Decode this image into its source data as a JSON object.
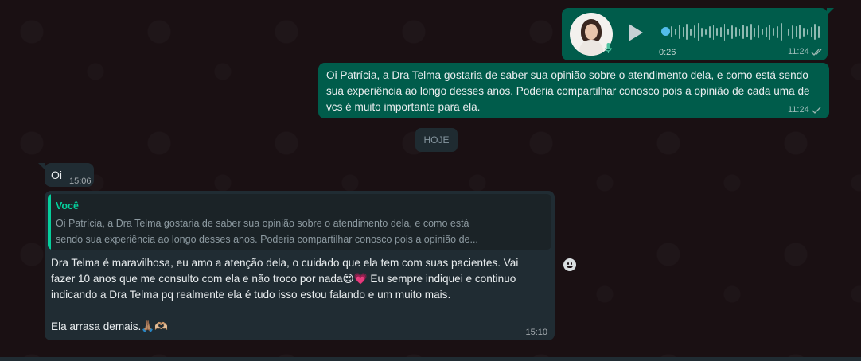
{
  "audio_message": {
    "duration": "0:26",
    "time": "11:24",
    "status_icon": "double-check-icon",
    "progress": 0
  },
  "outgoing_text": {
    "text": "Oi Patrícia, a Dra Telma gostaria de saber sua opinião sobre o atendimento dela, e como está sendo sua experiência ao longo desses anos. Poderia compartilhar conosco pois a opinião de cada uma de vcs é muito importante para ela.",
    "time": "11:24",
    "status_icon": "single-check-icon"
  },
  "date_separator": "HOJE",
  "incoming_oi": {
    "text": "Oi",
    "time": "15:06"
  },
  "incoming_reply": {
    "quote_author": "Você",
    "quote_text_line1": "Oi Patrícia, a Dra Telma gostaria de saber sua opinião sobre o atendimento dela, e como está",
    "quote_text_line2": "sendo sua experiência ao longo desses anos. Poderia compartilhar conosco pois a opinião de...",
    "body_p1": "Dra Telma é maravilhosa, eu amo a atenção dela, o cuidado que ela tem com suas pacientes. Vai fazer 10 anos que me consulto com ela e não troco por nada😍💗 Eu sempre indiquei e continuo indicando a Dra Telma pq realmente ela é tudo isso estou falando e um muito mais.",
    "body_p2": "Ela arrasa demais.🙏🏽🫶🏼",
    "time": "15:10"
  },
  "colors": {
    "outgoing_bubble": "#005c4b",
    "incoming_bubble": "#202c33",
    "accent": "#06cf9c",
    "background": "#1a1013"
  }
}
